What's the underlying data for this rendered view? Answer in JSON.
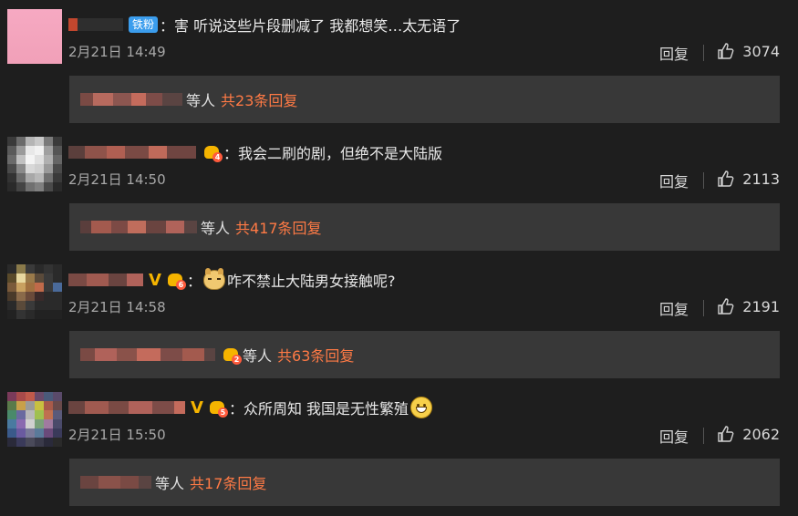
{
  "comments": [
    {
      "badge": "铁粉",
      "fan_level": "",
      "text": "：害 听说这些片段删减了 我都想笑…太无语了",
      "time": "2月21日 14:49",
      "reply_label": "回复",
      "likes": "3074",
      "reply_summary": {
        "suffix": "等人",
        "count": "共23条回复"
      }
    },
    {
      "badge": "",
      "fan_level": "4",
      "text": "：我会二刷的剧，但绝不是大陆版",
      "time": "2月21日 14:50",
      "reply_label": "回复",
      "likes": "2113",
      "reply_summary": {
        "suffix": "等人",
        "count": "共417条回复"
      }
    },
    {
      "badge": "",
      "fan_level": "6",
      "text": "咋不禁止大陆男女接触呢?",
      "prefix": "：",
      "time": "2月21日 14:58",
      "reply_label": "回复",
      "likes": "2191",
      "reply_summary": {
        "suffix": "等人",
        "count": "共63条回复",
        "fan_level": "2"
      }
    },
    {
      "badge": "",
      "fan_level": "5",
      "text": "：众所周知 我国是无性繁殖",
      "time": "2月21日 15:50",
      "reply_label": "回复",
      "likes": "2062",
      "reply_summary": {
        "suffix": "等人",
        "count": "共17条回复"
      }
    }
  ],
  "icons": {
    "like": "thumbs-up-icon",
    "vip": "vip-v-icon",
    "fan": "fan-crown-icon",
    "dog": "doge-emoji-icon",
    "grin": "grin-emoji-icon"
  },
  "colors": {
    "background": "#1e1e1e",
    "reply_box": "#383838",
    "accent_orange": "#ff7a45",
    "badge_blue": "#3b9ded",
    "vip_gold": "#f5b400"
  }
}
